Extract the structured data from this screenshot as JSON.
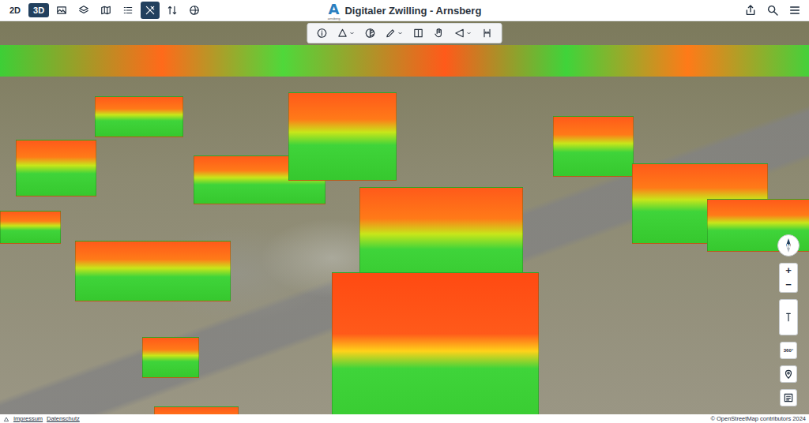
{
  "window": {
    "title": "Digitaler Zwilling - Arnsberg"
  },
  "logo": {
    "letter": "A",
    "caption": "arnsberg"
  },
  "view_modes": [
    {
      "label": "2D",
      "selected": false
    },
    {
      "label": "3D",
      "selected": true
    }
  ],
  "top_tools": [
    {
      "kind": "image",
      "selected": false
    },
    {
      "kind": "layers",
      "selected": false
    },
    {
      "kind": "map",
      "selected": false
    },
    {
      "kind": "legend",
      "selected": false
    },
    {
      "kind": "tools",
      "selected": true
    },
    {
      "kind": "swap",
      "selected": false
    },
    {
      "kind": "globe",
      "selected": false
    }
  ],
  "header_actions": [
    {
      "kind": "share"
    },
    {
      "kind": "search"
    },
    {
      "kind": "menu"
    }
  ],
  "toolbar": [
    {
      "kind": "info",
      "dropdown": false
    },
    {
      "kind": "measure",
      "dropdown": true
    },
    {
      "kind": "shade",
      "dropdown": false
    },
    {
      "kind": "draw",
      "dropdown": true
    },
    {
      "kind": "split",
      "dropdown": false
    },
    {
      "kind": "pan",
      "dropdown": false
    },
    {
      "kind": "share",
      "dropdown": true
    },
    {
      "kind": "ruler",
      "dropdown": false
    }
  ],
  "map_controls": {
    "compass": "N",
    "zoom_in": "+",
    "zoom_out": "−",
    "view_360": "360°"
  },
  "footer": {
    "links": [
      "Impressum",
      "Datenschutz"
    ],
    "attribution": "© OpenStreetMap contributors 2024"
  }
}
